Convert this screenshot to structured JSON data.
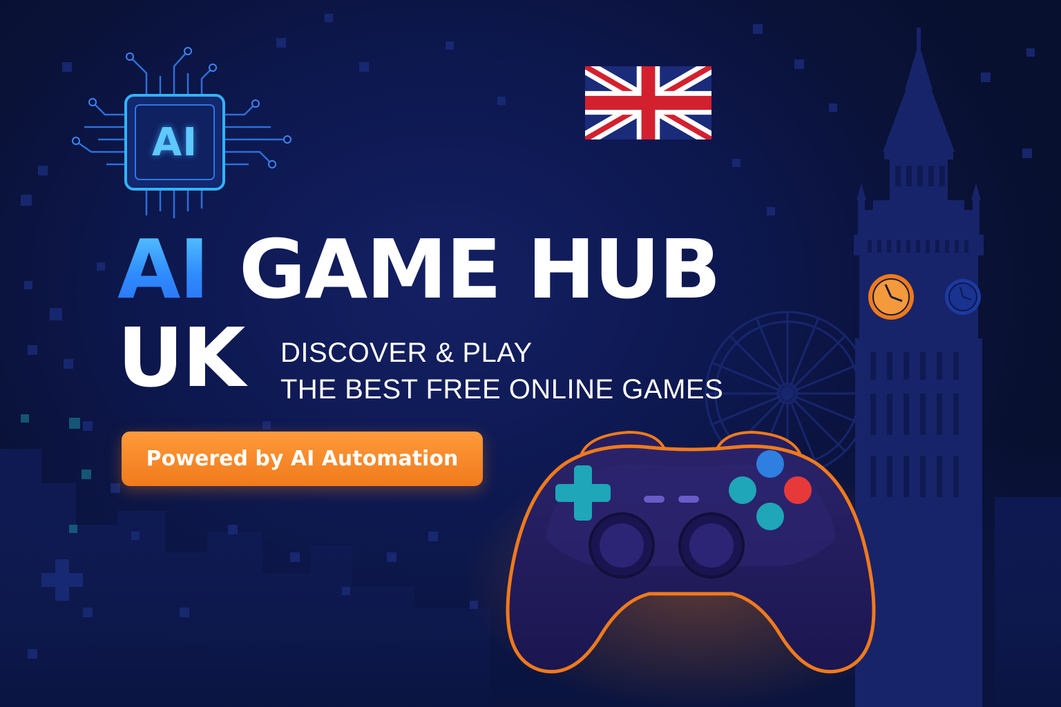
{
  "banner": {
    "chip_label": "AI",
    "title_highlight": "AI",
    "title_main": "GAME HUB",
    "title_second_line": "UK",
    "tagline_line1": "DISCOVER & PLAY",
    "tagline_line2": "THE BEST FREE ONLINE GAMES",
    "cta_label": "Powered by AI Automation"
  },
  "icons": {
    "chip": "ai-chip-icon",
    "flag": "uk-flag-icon",
    "tower": "big-ben-icon",
    "wheel": "ferris-wheel-icon",
    "controller": "gamepad-icon"
  },
  "colors": {
    "background": "#0d1850",
    "accent_blue": "#2f8cff",
    "accent_orange": "#f07a1c",
    "teal": "#1fa6b8",
    "red_button": "#e8393a",
    "blue_button": "#2f7fe0"
  }
}
